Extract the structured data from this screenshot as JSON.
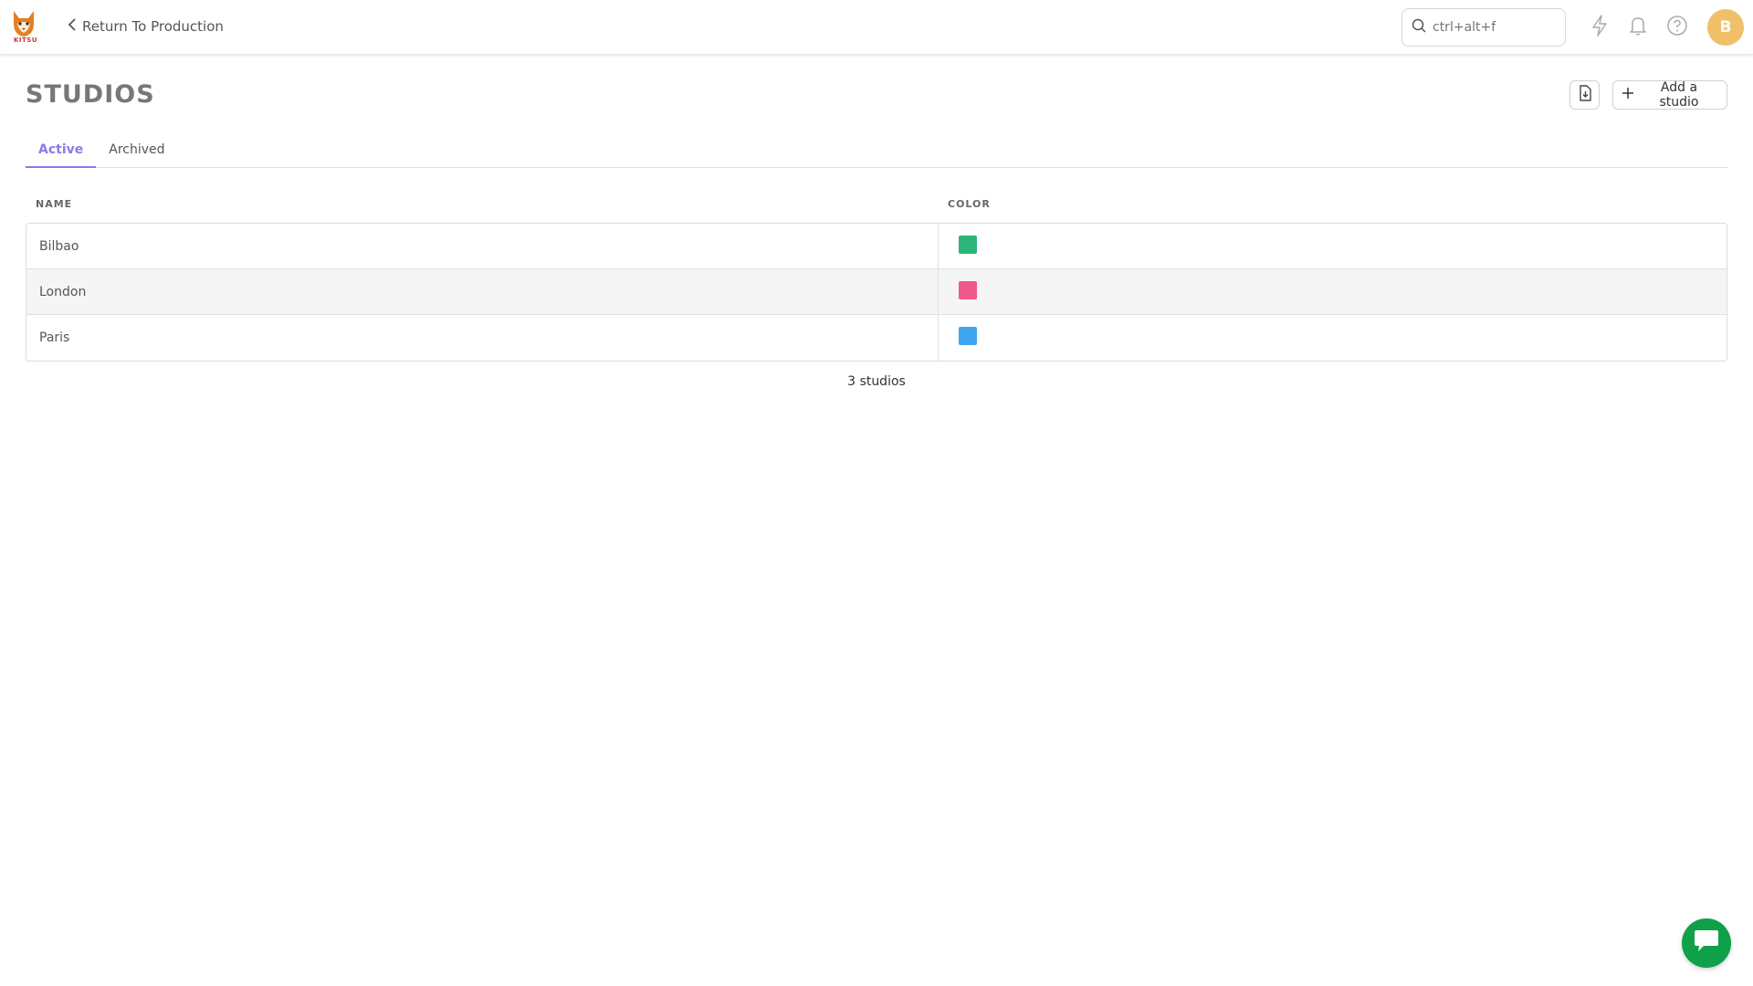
{
  "topbar": {
    "logo_text": "KITSU",
    "back_label": "Return To Production",
    "search": {
      "value": "",
      "placeholder": "ctrl+alt+f"
    },
    "icons": [
      "lightning-icon",
      "bell-icon",
      "help-icon"
    ],
    "avatar_initial": "B",
    "avatar_color": "#f0c069"
  },
  "page": {
    "title": "STUDIOS",
    "add_label": "Add a studio"
  },
  "tabs": [
    {
      "label": "Active",
      "active": true
    },
    {
      "label": "Archived",
      "active": false
    }
  ],
  "table": {
    "columns": {
      "name": "NAME",
      "color": "COLOR"
    },
    "rows": [
      {
        "name": "Bilbao",
        "color": "#2cb57a"
      },
      {
        "name": "London",
        "color": "#f0578a"
      },
      {
        "name": "Paris",
        "color": "#3fa5ee"
      }
    ]
  },
  "footer": {
    "count": "3 studios"
  },
  "colors": {
    "accent": "#8c7ae6",
    "chat": "#0fa04a"
  }
}
